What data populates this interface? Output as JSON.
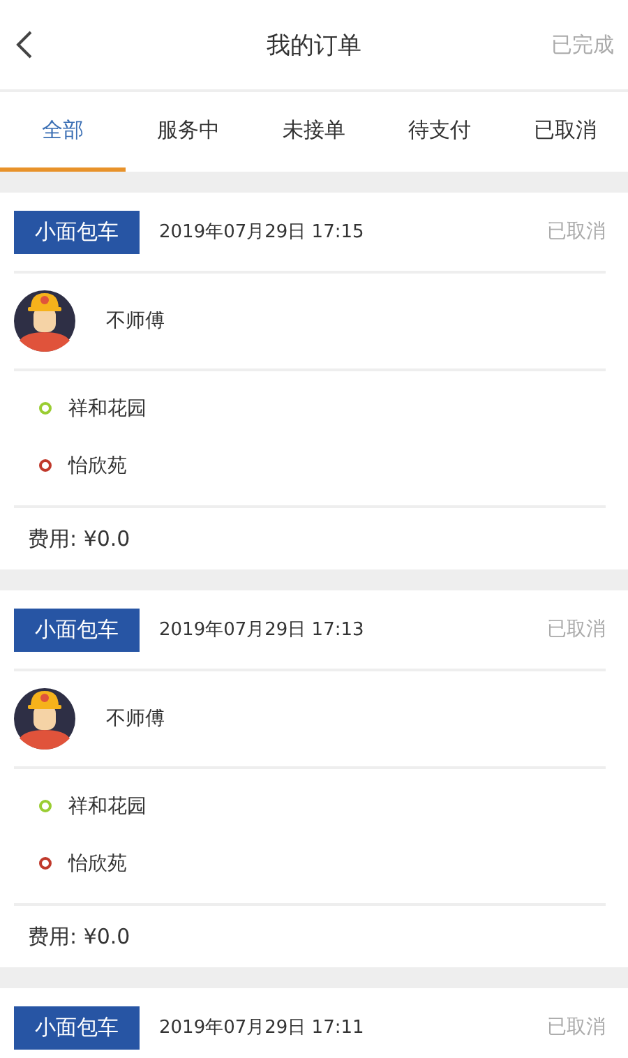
{
  "header": {
    "title": "我的订单",
    "action": "已完成"
  },
  "tabs": [
    {
      "label": "全部",
      "selected": true
    },
    {
      "label": "服务中",
      "selected": false
    },
    {
      "label": "未接单",
      "selected": false
    },
    {
      "label": "待支付",
      "selected": false
    },
    {
      "label": "已取消",
      "selected": false
    }
  ],
  "orders": [
    {
      "vehicle": "小面包车",
      "time": "2019年07月29日 17:15",
      "status": "已取消",
      "driver": "不师傅",
      "stops": [
        {
          "name": "祥和花园",
          "color": "#9acd32"
        },
        {
          "name": "怡欣苑",
          "color": "#c0392b"
        }
      ],
      "fee": "费用: ¥0.0"
    },
    {
      "vehicle": "小面包车",
      "time": "2019年07月29日 17:13",
      "status": "已取消",
      "driver": "不师傅",
      "stops": [
        {
          "name": "祥和花园",
          "color": "#9acd32"
        },
        {
          "name": "怡欣苑",
          "color": "#c0392b"
        }
      ],
      "fee": "费用: ¥0.0"
    },
    {
      "vehicle": "小面包车",
      "time": "2019年07月29日 17:11",
      "status": "已取消"
    }
  ]
}
